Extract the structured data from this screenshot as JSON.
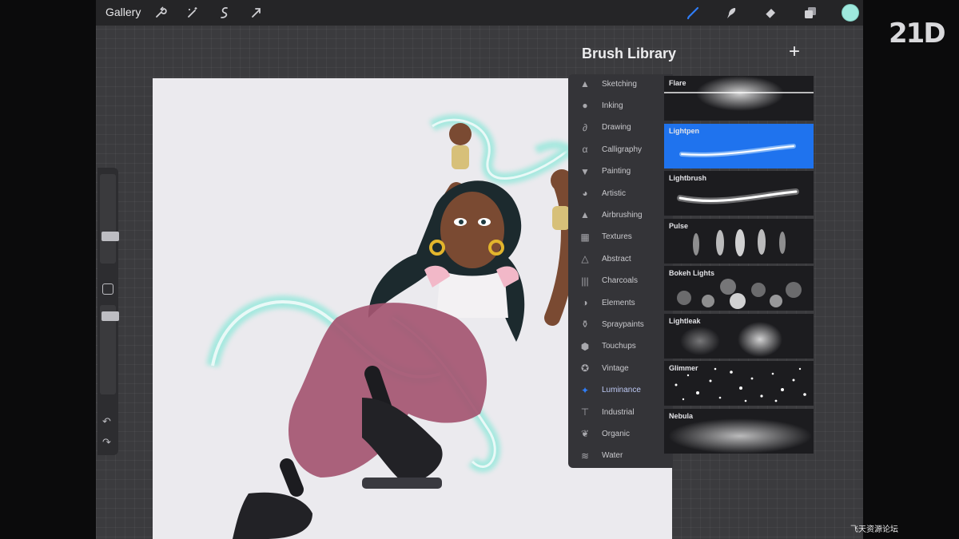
{
  "topbar": {
    "gallery_label": "Gallery",
    "left_tools": [
      "wrench-icon",
      "magic-wand-icon",
      "selection-icon",
      "transform-arrow-icon"
    ],
    "right_tools": [
      "brush-icon",
      "smudge-icon",
      "eraser-icon",
      "layers-icon"
    ],
    "active_tool": "brush-icon",
    "current_color": "#9ee8dd"
  },
  "brush_library": {
    "title": "Brush Library",
    "add_label": "+",
    "categories": [
      {
        "label": "Sketching",
        "icon": "pencil-tip-icon"
      },
      {
        "label": "Inking",
        "icon": "ink-drop-icon"
      },
      {
        "label": "Drawing",
        "icon": "swirl-icon"
      },
      {
        "label": "Calligraphy",
        "icon": "calligraphy-icon"
      },
      {
        "label": "Painting",
        "icon": "paint-brush-icon"
      },
      {
        "label": "Artistic",
        "icon": "palette-icon"
      },
      {
        "label": "Airbrushing",
        "icon": "airbrush-icon"
      },
      {
        "label": "Textures",
        "icon": "texture-icon"
      },
      {
        "label": "Abstract",
        "icon": "triangle-icon"
      },
      {
        "label": "Charcoals",
        "icon": "charcoal-icon"
      },
      {
        "label": "Elements",
        "icon": "yin-yang-icon"
      },
      {
        "label": "Spraypaints",
        "icon": "spray-can-icon"
      },
      {
        "label": "Touchups",
        "icon": "touchup-icon"
      },
      {
        "label": "Vintage",
        "icon": "star-badge-icon"
      },
      {
        "label": "Luminance",
        "icon": "sparkle-icon"
      },
      {
        "label": "Industrial",
        "icon": "anvil-icon"
      },
      {
        "label": "Organic",
        "icon": "leaf-icon"
      },
      {
        "label": "Water",
        "icon": "waves-icon"
      }
    ],
    "active_category": "Luminance",
    "brushes": [
      "Flare",
      "Lightpen",
      "Lightbrush",
      "Pulse",
      "Bokeh Lights",
      "Lightleak",
      "Glimmer",
      "Nebula"
    ],
    "selected_brush": "Lightpen"
  },
  "sidebar": {
    "undo_icon": "undo-icon",
    "redo_icon": "redo-icon",
    "brush_size": 0.72,
    "opacity": 0.25
  },
  "colors": {
    "accent_blue": "#1f73ee",
    "glow_teal": "#9ee8dd"
  },
  "overlays": {
    "logo": "21D",
    "watermark": "飞天资源论坛"
  }
}
